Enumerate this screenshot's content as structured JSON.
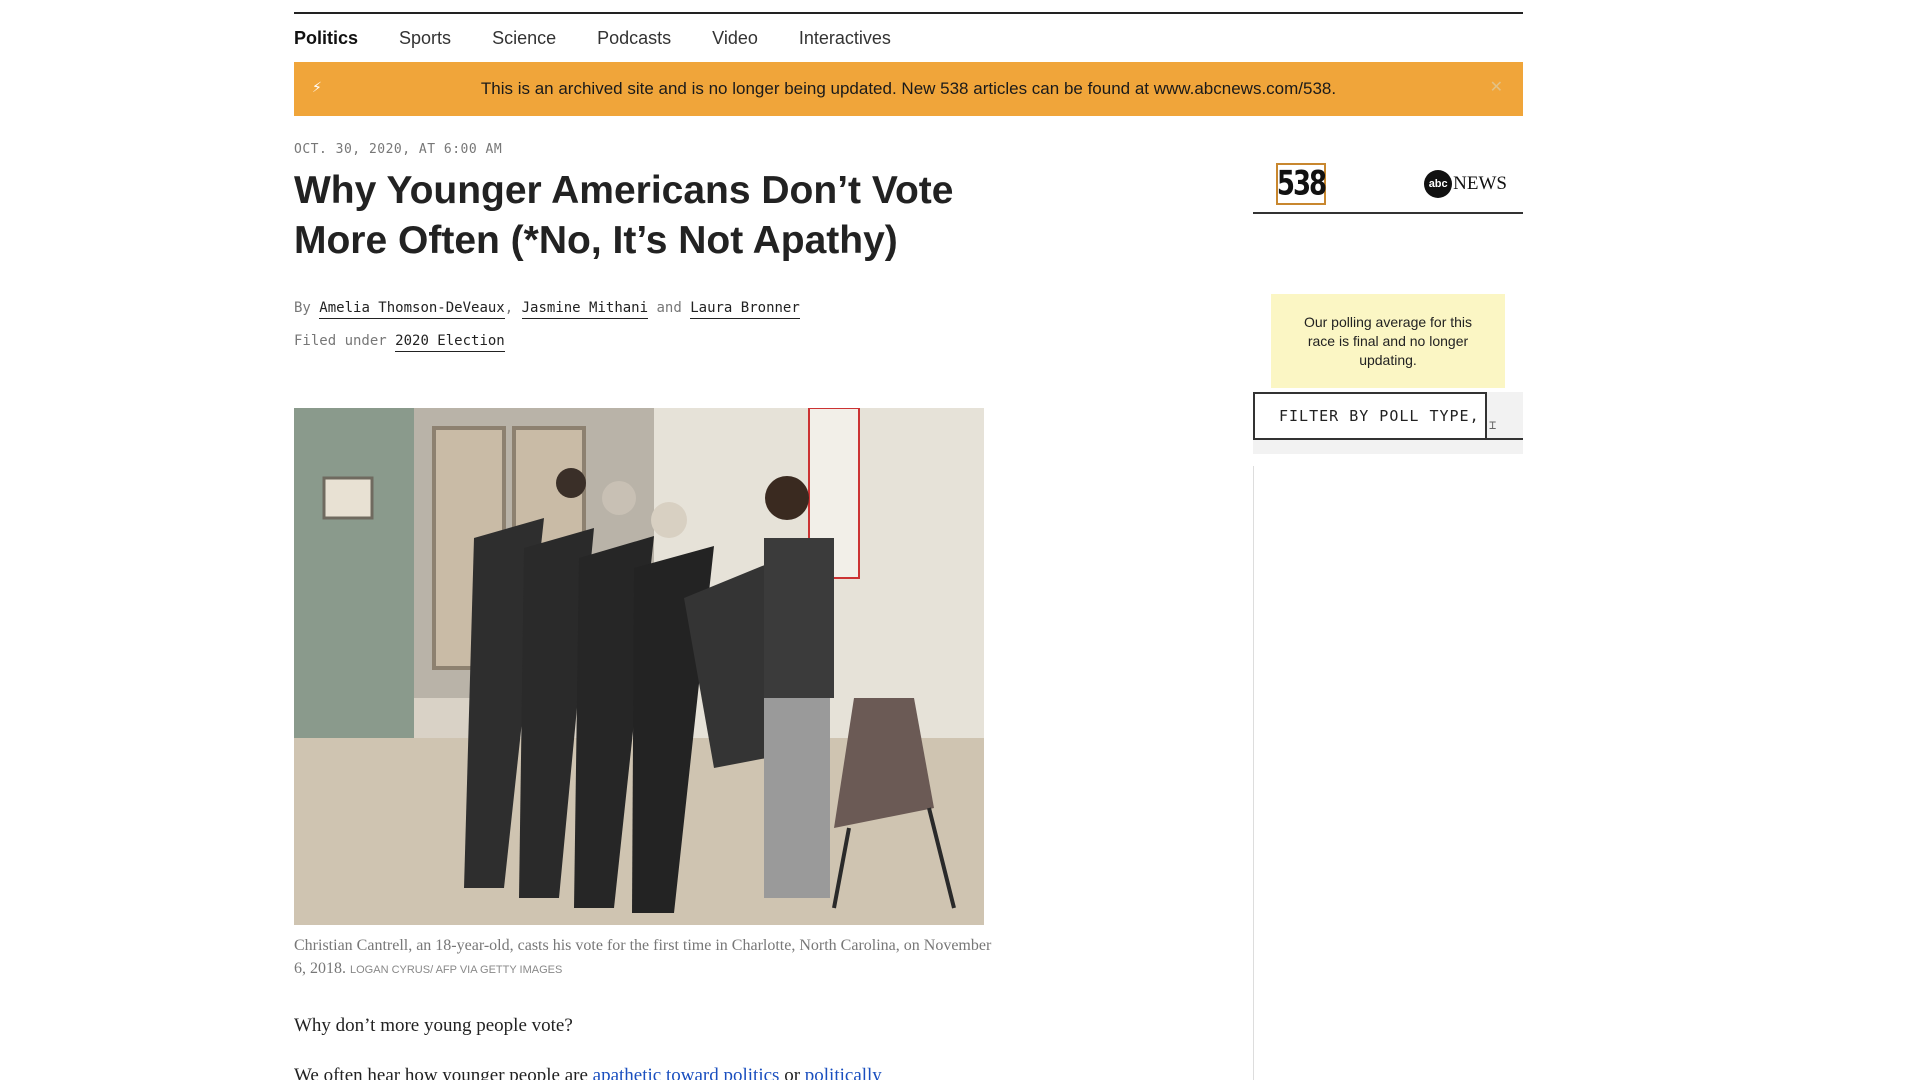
{
  "nav": {
    "items": [
      {
        "label": "Politics",
        "active": true
      },
      {
        "label": "Sports",
        "active": false
      },
      {
        "label": "Science",
        "active": false
      },
      {
        "label": "Podcasts",
        "active": false
      },
      {
        "label": "Video",
        "active": false
      },
      {
        "label": "Interactives",
        "active": false
      }
    ]
  },
  "banner": {
    "text": "This is an archived site and is no longer being updated. New 538 articles can be found at www.abcnews.com/538.",
    "color": "#f0a53a"
  },
  "article": {
    "dateline": "OCT. 30, 2020, AT 6:00 AM",
    "title": "Why Younger Americans Don’t Vote More Often (*No, It’s Not Apathy)",
    "byline": {
      "prefix": "By",
      "authors": [
        "Amelia Thomson-DeVeaux",
        "Jasmine Mithani",
        "Laura Bronner"
      ],
      "sep1": ",",
      "sep2": "and"
    },
    "filed": {
      "prefix": "Filed under",
      "tag": "2020 Election"
    },
    "image_caption": "Christian Cantrell, an 18-year-old, casts his vote for the first time in Charlotte, North Carolina, on November 6, 2018.",
    "image_credit": "LOGAN CYRUS/ AFP VIA GETTY IMAGES",
    "body": {
      "p1": "Why don’t more young people vote?",
      "p2_start": "We often hear how younger people are",
      "p2_link1": "apathetic toward politics",
      "p2_mid": "or",
      "p2_link2": "politically"
    }
  },
  "sidebar": {
    "logo_538": "538",
    "logo_abc_circle": "abc",
    "logo_abc_news": "NEWS",
    "notice": "Our polling average for this race is final and no longer updating.",
    "filter_label": "FILTER BY POLL TYPE,",
    "notice_color": "#fbf6c4",
    "accent_color": "#c8872f"
  }
}
